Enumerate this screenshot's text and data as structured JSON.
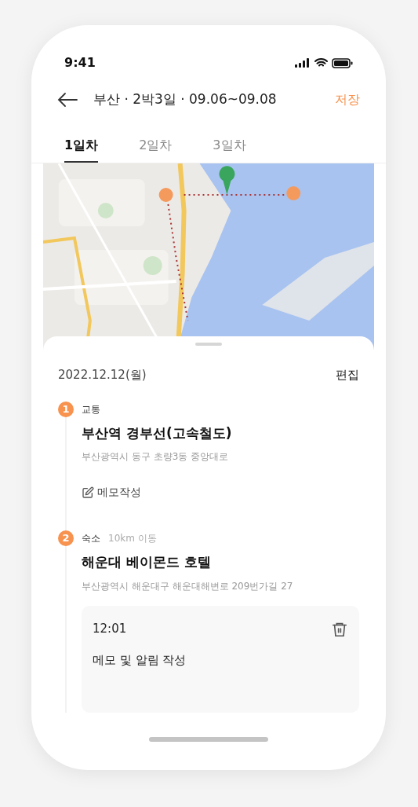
{
  "status_bar": {
    "time": "9:41"
  },
  "header": {
    "title": "부산 · 2박3일 · 09.06~09.08",
    "save": "저장"
  },
  "tabs": [
    {
      "label": "1일차",
      "selected": true
    },
    {
      "label": "2일차",
      "selected": false
    },
    {
      "label": "3일차",
      "selected": false
    }
  ],
  "sheet": {
    "date": "2022.12.12(월)",
    "edit": "편집",
    "stops": [
      {
        "number": "1",
        "category": "교통",
        "name": "부산역 경부선(고속철도)",
        "address": "부산광역시 동구 초량3동 중앙대로",
        "memo": {
          "kind": "link",
          "label": "메모작성"
        }
      },
      {
        "number": "2",
        "category": "숙소",
        "distance": "10km 이동",
        "name": "해운대 베이몬드 호텔",
        "address": "부산광역시 해운대구 해운대해변로 209번가길 27",
        "memo": {
          "kind": "card",
          "time": "12:01",
          "text": "메모 및 알림 작성"
        }
      }
    ]
  }
}
